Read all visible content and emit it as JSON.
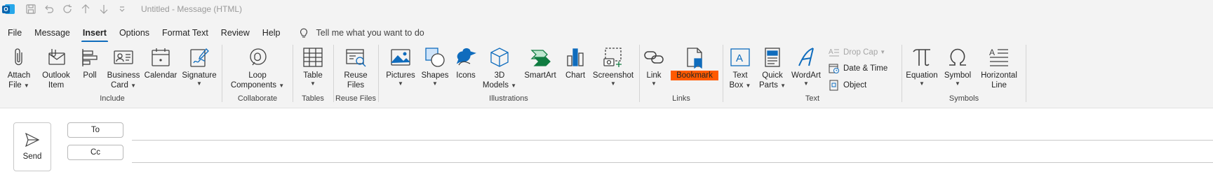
{
  "titlebar": {
    "title": "Untitled  -  Message (HTML)",
    "app_icon": "outlook-logo",
    "qat": [
      "save-icon",
      "undo-icon",
      "redo-icon",
      "up-arrow-icon",
      "down-arrow-icon",
      "customize-qat-icon"
    ]
  },
  "tabs": [
    {
      "label": "File"
    },
    {
      "label": "Message"
    },
    {
      "label": "Insert",
      "active": true
    },
    {
      "label": "Options"
    },
    {
      "label": "Format Text"
    },
    {
      "label": "Review"
    },
    {
      "label": "Help"
    }
  ],
  "tellme": "Tell me what you want to do",
  "ribbon": {
    "include": {
      "label": "Include",
      "attach_file": [
        "Attach",
        "File"
      ],
      "outlook_item": [
        "Outlook",
        "Item"
      ],
      "poll": "Poll",
      "business_card": [
        "Business",
        "Card"
      ],
      "calendar": "Calendar",
      "signature": "Signature"
    },
    "collaborate": {
      "label": "Collaborate",
      "loop": [
        "Loop",
        "Components"
      ]
    },
    "tables": {
      "label": "Tables",
      "table": "Table"
    },
    "reuse": {
      "label": "Reuse Files",
      "reuse_files": [
        "Reuse",
        "Files"
      ]
    },
    "illustrations": {
      "label": "Illustrations",
      "pictures": "Pictures",
      "shapes": "Shapes",
      "icons": "Icons",
      "models": [
        "3D",
        "Models"
      ],
      "smartart": "SmartArt",
      "chart": "Chart",
      "screenshot": "Screenshot"
    },
    "links": {
      "label": "Links",
      "link": "Link",
      "bookmark": "Bookmark",
      "highlight_color": "#ff5a00"
    },
    "text": {
      "label": "Text",
      "text_box": [
        "Text",
        "Box"
      ],
      "quick_parts": [
        "Quick",
        "Parts"
      ],
      "wordart": "WordArt",
      "drop_cap": "Drop Cap",
      "date_time": "Date & Time",
      "object": "Object"
    },
    "symbols": {
      "label": "Symbols",
      "equation": "Equation",
      "symbol": "Symbol",
      "horizontal_line": [
        "Horizontal",
        "Line"
      ]
    }
  },
  "compose": {
    "send": "Send",
    "to": "To",
    "cc": "Cc"
  },
  "colors": {
    "accent": "#0f6cbd",
    "icon_blue": "#0f6cbd",
    "bookmark_highlight": "#ff5a00"
  }
}
